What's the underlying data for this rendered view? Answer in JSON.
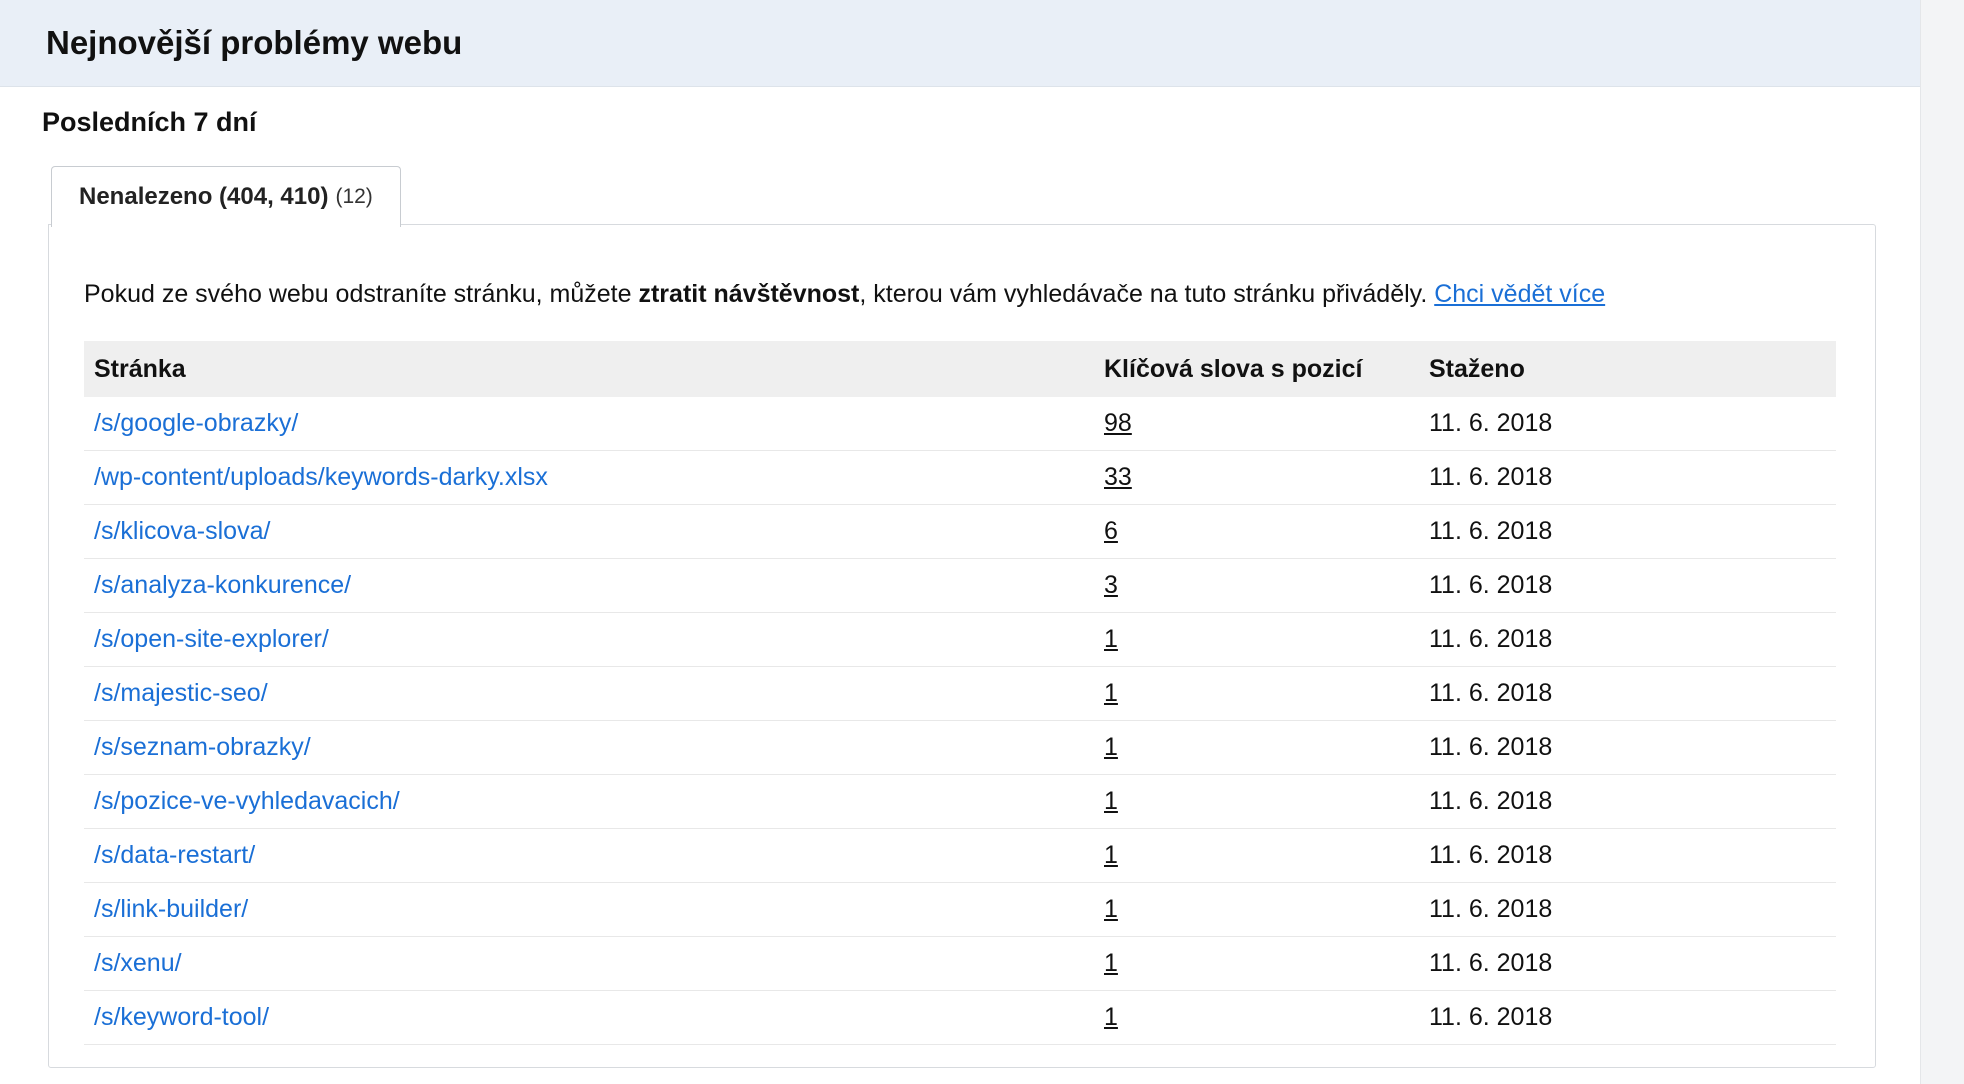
{
  "header": {
    "title": "Nejnovější problémy webu"
  },
  "period": {
    "label": "Posledních 7 dní"
  },
  "tab": {
    "label": "Nenalezeno (404, 410)",
    "count": "(12)"
  },
  "intro": {
    "before": "Pokud ze svého webu odstraníte stránku, můžete ",
    "bold": "ztratit návštěvnost",
    "after": ", kterou vám vyhledávače na tuto stránku přiváděly. ",
    "link": "Chci vědět více"
  },
  "table": {
    "columns": [
      "Stránka",
      "Klíčová slova s pozicí",
      "Staženo"
    ],
    "rows": [
      {
        "page": "/s/google-obrazky/",
        "keywords": "98",
        "date": "11. 6. 2018"
      },
      {
        "page": "/wp-content/uploads/keywords-darky.xlsx",
        "keywords": "33",
        "date": "11. 6. 2018"
      },
      {
        "page": "/s/klicova-slova/",
        "keywords": "6",
        "date": "11. 6. 2018"
      },
      {
        "page": "/s/analyza-konkurence/",
        "keywords": "3",
        "date": "11. 6. 2018"
      },
      {
        "page": "/s/open-site-explorer/",
        "keywords": "1",
        "date": "11. 6. 2018"
      },
      {
        "page": "/s/majestic-seo/",
        "keywords": "1",
        "date": "11. 6. 2018"
      },
      {
        "page": "/s/seznam-obrazky/",
        "keywords": "1",
        "date": "11. 6. 2018"
      },
      {
        "page": "/s/pozice-ve-vyhledavacich/",
        "keywords": "1",
        "date": "11. 6. 2018"
      },
      {
        "page": "/s/data-restart/",
        "keywords": "1",
        "date": "11. 6. 2018"
      },
      {
        "page": "/s/link-builder/",
        "keywords": "1",
        "date": "11. 6. 2018"
      },
      {
        "page": "/s/xenu/",
        "keywords": "1",
        "date": "11. 6. 2018"
      },
      {
        "page": "/s/keyword-tool/",
        "keywords": "1",
        "date": "11. 6. 2018"
      }
    ]
  },
  "colors": {
    "link": "#1a6fd6",
    "header_bg": "#e9eff7",
    "table_header_bg": "#efefef"
  }
}
